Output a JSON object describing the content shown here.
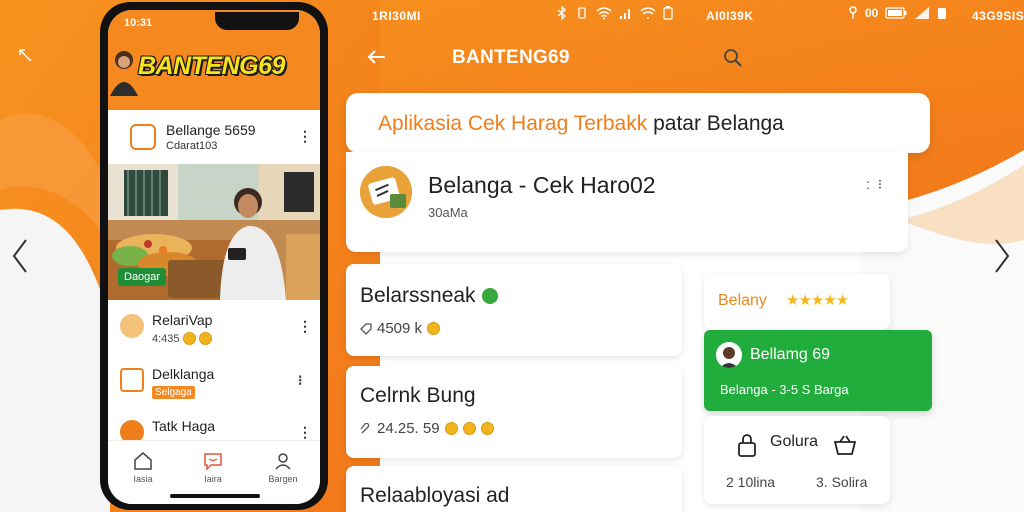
{
  "colors": {
    "brand_orange": "#f5891f",
    "accent_green": "#21ad3c",
    "star_gold": "#f5b81c"
  },
  "status_bar": {
    "left_text": "1RI30MI",
    "right_text": "AI0I39K",
    "far_right_text": "43G9SIS",
    "icons": [
      "bluetooth-icon",
      "wifi-icon",
      "signal-icon",
      "battery-icon"
    ]
  },
  "app_header": {
    "title": "BANTENG69",
    "back_icon": "arrow-left-icon",
    "search_icon": "search-icon"
  },
  "tagline": {
    "orange_part": "Aplikasia Cek Harag Terbakk",
    "plain_part": " patar ",
    "dark_part": "Belanga"
  },
  "main_card": {
    "title": "Belanga - Cek Haro02",
    "subtitle": "30aMa",
    "more": ": ⁝"
  },
  "list_cards": [
    {
      "title": "Belarssneak",
      "meta": "4509 k"
    },
    {
      "title": "Celrnk Bung",
      "meta": "24.25. 59"
    },
    {
      "title": "Relaabloyasi ad",
      "meta": ""
    }
  ],
  "rating_card": {
    "label": "Belany",
    "stars": 5
  },
  "green_card": {
    "title": "Bellamg 69",
    "subtitle": "Belanga - 3-5 S Barga"
  },
  "stats_card": {
    "label": "Golura",
    "left": "2 10lina",
    "right": "3. Solira"
  },
  "phone": {
    "time": "10:31",
    "logo": "BANTENG69",
    "app_row": {
      "title": "Bellange 5659",
      "subtitle": "Cdarat103"
    },
    "banner_badge": "Daogar",
    "items": [
      {
        "title": "RelariVap",
        "subtitle": "4:435"
      },
      {
        "title": "Delklanga",
        "subtitle": "",
        "tag": "Selgaga"
      },
      {
        "title": "Tatk Haga",
        "subtitle": "…"
      }
    ],
    "tabs": [
      {
        "label": "Iasia",
        "icon": "home-icon"
      },
      {
        "label": "Iaira",
        "icon": "chat-icon"
      },
      {
        "label": "Bargen",
        "icon": "profile-icon"
      }
    ]
  }
}
